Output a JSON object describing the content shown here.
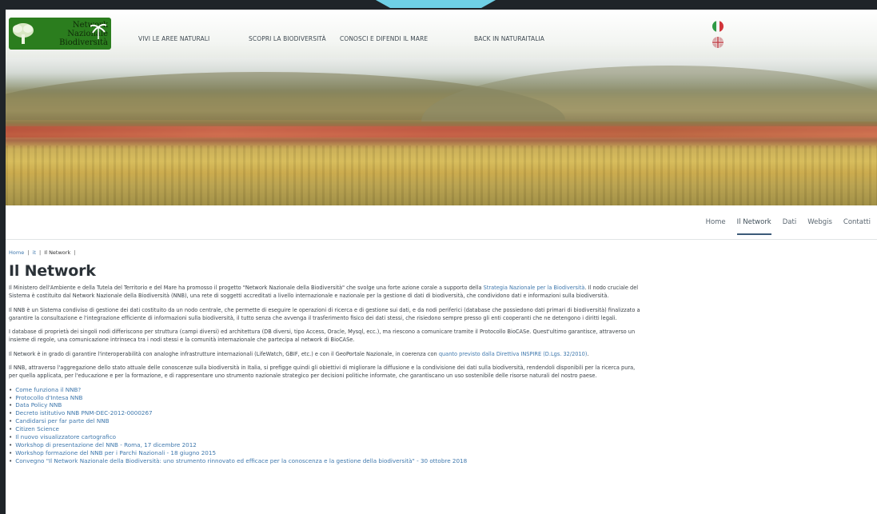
{
  "logo": {
    "line1": "Network",
    "line2": "Nazionale",
    "line3": "Biodiversità"
  },
  "topnav": [
    "VIVI LE AREE NATURALI",
    "SCOPRI LA BIODIVERSITÀ",
    "CONOSCI E DIFENDI IL MARE",
    "BACK IN NATURAITALIA"
  ],
  "languages": [
    "it",
    "en"
  ],
  "subnav": {
    "items": [
      "Home",
      "Il Network",
      "Dati",
      "Webgis",
      "Contatti"
    ],
    "active": "Il Network"
  },
  "breadcrumb": {
    "home": "Home",
    "sep": "|",
    "it": "it",
    "current": "Il Network"
  },
  "page_title": "Il Network",
  "paragraphs": {
    "p1": {
      "a": "Il Ministero dell'Ambiente e della Tutela del Territorio e del Mare ha promosso il progetto \"Network Nazionale della Biodiversità\" che svolge una forte azione corale a supporto della ",
      "link": "Strategia Nazionale per la Biodiversità",
      "b": ". Il nodo cruciale del",
      "c": "Sistema è costituito dal Network Nazionale della Biodiversità (NNB), una rete di soggetti accreditati a livello internazionale e nazionale per la gestione di dati di biodiversità, che condividono dati e informazioni sulla biodiversità."
    },
    "p2": {
      "a": "Il NNB è un Sistema condiviso di gestione dei dati costituito da un nodo centrale, che permette di eseguire le operazioni di ricerca e di gestione sui dati, e da nodi periferici (database che possiedono dati primari di biodiversità) finalizzato a",
      "b": "garantire la consultazione e l'integrazione efficiente di informazioni sulla biodiversità, il tutto senza che avvenga il trasferimento fisico dei dati stessi, che risiedono sempre presso gli enti cooperanti che ne detengono i diritti legali."
    },
    "p3": {
      "a": "I database di proprietà dei singoli nodi differiscono per struttura (campi diversi) ed architettura (DB diversi, tipo Access, Oracle, Mysql, ecc.), ma riescono a comunicare tramite il Protocollo BioCASe. Quest'ultimo garantisce, attraverso un",
      "b": "insieme di regole, una comunicazione intrinseca tra i nodi stessi e la comunità internazionale che partecipa al network di BioCASe."
    },
    "p4": {
      "a": "Il Network è in grado di garantire l'interoperabilità con analoghe infrastrutture internazionali (LifeWatch, GBIF, etc.) e con il GeoPortale Nazionale, in coerenza con ",
      "link": "quanto previsto dalla Direttiva INSPIRE (D.Lgs. 32/2010)",
      "b": "."
    },
    "p5": {
      "a": "Il NNB, attraverso l'aggregazione dello stato attuale delle conoscenze sulla biodiversità in Italia, si prefigge quindi gli obiettivi di migliorare la diffusione e la condivisione dei dati sulla biodiversità, rendendoli disponibili per la ricerca pura,",
      "b": "per quella applicata, per l'educazione e per la formazione, e di rappresentare uno strumento nazionale strategico per decisioni politiche informate, che garantiscano un uso sostenibile delle risorse naturali del nostro paese."
    }
  },
  "bullet": "•",
  "links": [
    "Come funziona il NNB?",
    "Protocollo d'Intesa NNB",
    "Data Policy NNB",
    "Decreto istitutivo NNB PNM-DEC-2012-0000267",
    "Candidarsi per far parte del NNB",
    "Citizen Science",
    "Il nuovo visualizzatore cartografico",
    "Workshop di presentazione del NNB - Roma, 17 dicembre 2012",
    "Workshop formazione del NNB per i Parchi Nazionali - 18 giugno 2015",
    "Convegno \"Il Network Nazionale della Biodiversità: uno strumento rinnovato ed efficace per la conoscenza e la gestione della biodiversità\" - 30 ottobre 2018"
  ],
  "colors": {
    "link": "#3f78ad",
    "logo_bg": "#2b7d1e",
    "frame_accent": "#6fd0e6"
  }
}
